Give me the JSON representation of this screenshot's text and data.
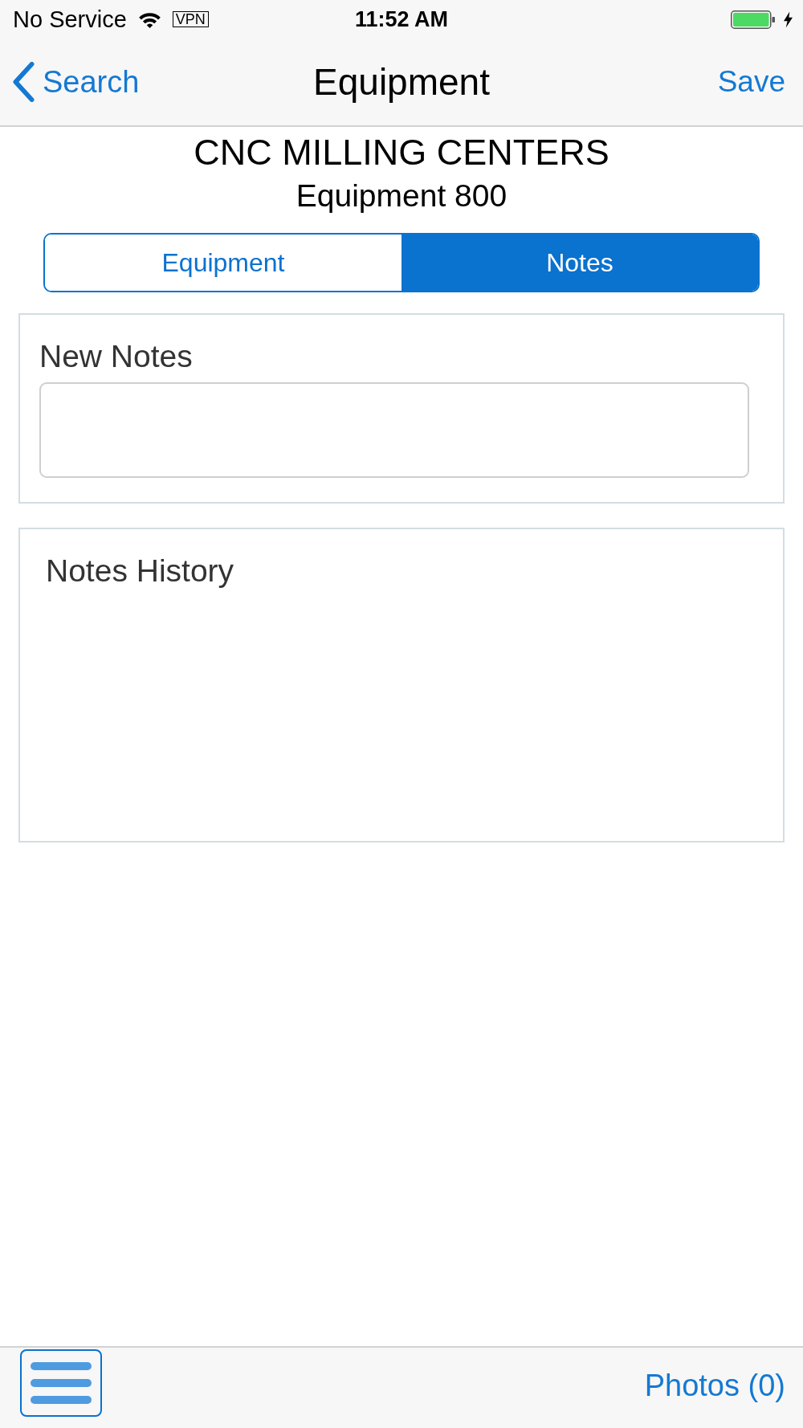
{
  "status_bar": {
    "carrier": "No Service",
    "vpn": "VPN",
    "time": "11:52 AM",
    "charging": true
  },
  "nav_bar": {
    "back": "Search",
    "title": "Equipment",
    "action": "Save"
  },
  "header": {
    "title": "CNC MILLING CENTERS",
    "subtitle": "Equipment 800"
  },
  "tabs": [
    {
      "label": "Equipment",
      "selected": false
    },
    {
      "label": "Notes",
      "selected": true
    }
  ],
  "new_notes": {
    "label": "New Notes"
  },
  "notes_history": {
    "title": "Notes History"
  },
  "bottom_bar": {
    "photos": "Photos (0)"
  }
}
